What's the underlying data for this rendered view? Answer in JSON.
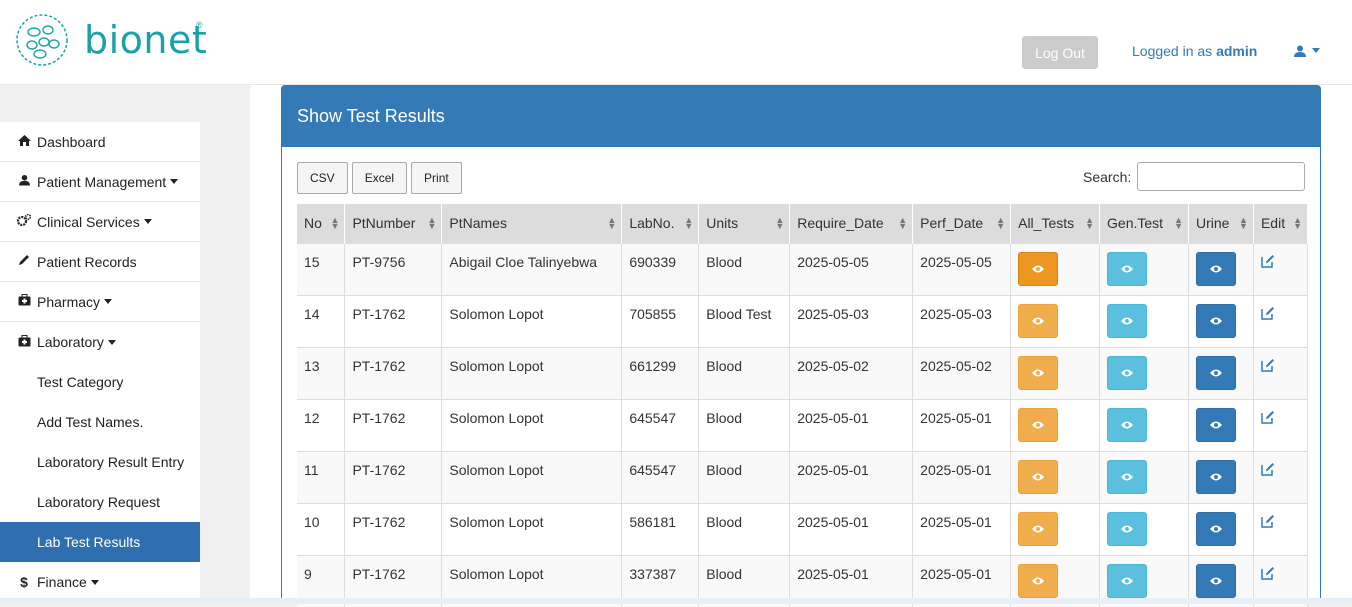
{
  "brand": {
    "name": "bionet",
    "reg": "®"
  },
  "header": {
    "logout_label": "Log Out",
    "logged_in_prefix": "Logged in as",
    "username": "admin",
    "user_icon": "user-icon"
  },
  "sidebar": {
    "items": [
      {
        "label": "Dashboard",
        "icon": "home-icon",
        "caret": false
      },
      {
        "label": "Patient Management",
        "icon": "user-icon",
        "caret": true
      },
      {
        "label": "Clinical Services",
        "icon": "gears-icon",
        "caret": true
      },
      {
        "label": "Patient Records",
        "icon": "pencil-icon",
        "caret": false
      },
      {
        "label": "Pharmacy",
        "icon": "medkit-icon",
        "caret": true
      },
      {
        "label": "Laboratory",
        "icon": "medkit-icon",
        "caret": true
      }
    ],
    "lab_sub": [
      {
        "label": "Test Category",
        "active": false
      },
      {
        "label": "Add Test Names.",
        "active": false
      },
      {
        "label": "Laboratory Result Entry",
        "active": false
      },
      {
        "label": "Laboratory Request",
        "active": false
      },
      {
        "label": "Lab Test Results",
        "active": true
      }
    ],
    "finance": {
      "label": "Finance",
      "icon": "dollar-icon"
    }
  },
  "panel": {
    "title": "Show Test Results",
    "buttons": [
      "CSV",
      "Excel",
      "Print"
    ],
    "search_label": "Search:",
    "search_value": ""
  },
  "table": {
    "columns": [
      "No",
      "PtNumber",
      "PtNames",
      "LabNo.",
      "Units",
      "Require_Date",
      "Perf_Date",
      "All_Tests",
      "Gen.Test",
      "Urine",
      "Edit"
    ],
    "rows": [
      [
        "15",
        "PT-9756",
        "Abigail Cloe Talinyebwa",
        "690339",
        "Blood",
        "2025-05-05",
        "2025-05-05"
      ],
      [
        "14",
        "PT-1762",
        "Solomon Lopot",
        "705855",
        "Blood Test",
        "2025-05-03",
        "2025-05-03"
      ],
      [
        "13",
        "PT-1762",
        "Solomon Lopot",
        "661299",
        "Blood",
        "2025-05-02",
        "2025-05-02"
      ],
      [
        "12",
        "PT-1762",
        "Solomon Lopot",
        "645547",
        "Blood",
        "2025-05-01",
        "2025-05-01"
      ],
      [
        "11",
        "PT-1762",
        "Solomon Lopot",
        "645547",
        "Blood",
        "2025-05-01",
        "2025-05-01"
      ],
      [
        "10",
        "PT-1762",
        "Solomon Lopot",
        "586181",
        "Blood",
        "2025-05-01",
        "2025-05-01"
      ],
      [
        "9",
        "PT-1762",
        "Solomon Lopot",
        "337387",
        "Blood",
        "2025-05-01",
        "2025-05-01"
      ]
    ]
  },
  "colors": {
    "primary": "#337ab7",
    "warning": "#f0ad4e",
    "info": "#5bc0de",
    "brand": "#1aa2a8"
  }
}
